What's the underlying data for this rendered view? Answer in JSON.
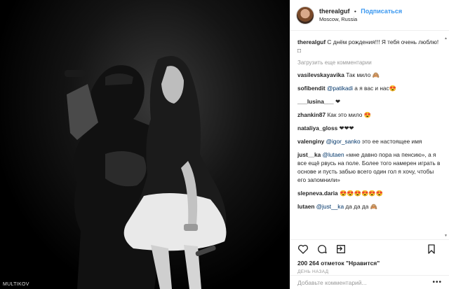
{
  "photo": {
    "watermark": "MULTIKOV"
  },
  "header": {
    "username": "therealguf",
    "separator": "•",
    "follow_label": "Подписаться",
    "location": "Moscow, Russia"
  },
  "caption": {
    "username": "therealguf",
    "text": "С днём рождения!!! Я тебя очень люблю!□"
  },
  "load_more": "Загрузить еще комментарии",
  "comments": [
    {
      "user": "vasilevskayavika",
      "mention": "",
      "text": "Так мило 🙈"
    },
    {
      "user": "sofibendit",
      "mention": "@patikadi",
      "text": "а я вас и нас😍"
    },
    {
      "user": "___lusina___",
      "mention": "",
      "text": "❤"
    },
    {
      "user": "zhankin87",
      "mention": "",
      "text": "Как это мило 😍"
    },
    {
      "user": "nataliya_gloss",
      "mention": "",
      "text": "❤❤❤"
    },
    {
      "user": "valenginy",
      "mention": "@igor_sanko",
      "text": "это ее настоящее имя"
    },
    {
      "user": "just__ka",
      "mention": "@lutaen",
      "text": "«мне давно пора на пенсию», а я все ещё рвусь на поле. Более того намерен играть в основе и пусть забью всего один гол я хочу, чтобы его запомнили»"
    },
    {
      "user": "slepneva.daria",
      "mention": "",
      "text": "😍😍😍😍😍😍"
    },
    {
      "user": "lutaen",
      "mention": "@just__ka",
      "text": "да да да 🙈"
    }
  ],
  "actions": {
    "like": "heart-icon",
    "comment": "comment-icon",
    "share": "share-icon",
    "save": "bookmark-icon"
  },
  "likes_text": "200 264 отметок \"Нравится\"",
  "timestamp": "ДЕНЬ НАЗАД",
  "add_comment": {
    "placeholder": "Добавьте комментарий...",
    "more": "•••"
  },
  "colors": {
    "link": "#3897f0",
    "mention": "#003569",
    "muted": "#999999"
  }
}
